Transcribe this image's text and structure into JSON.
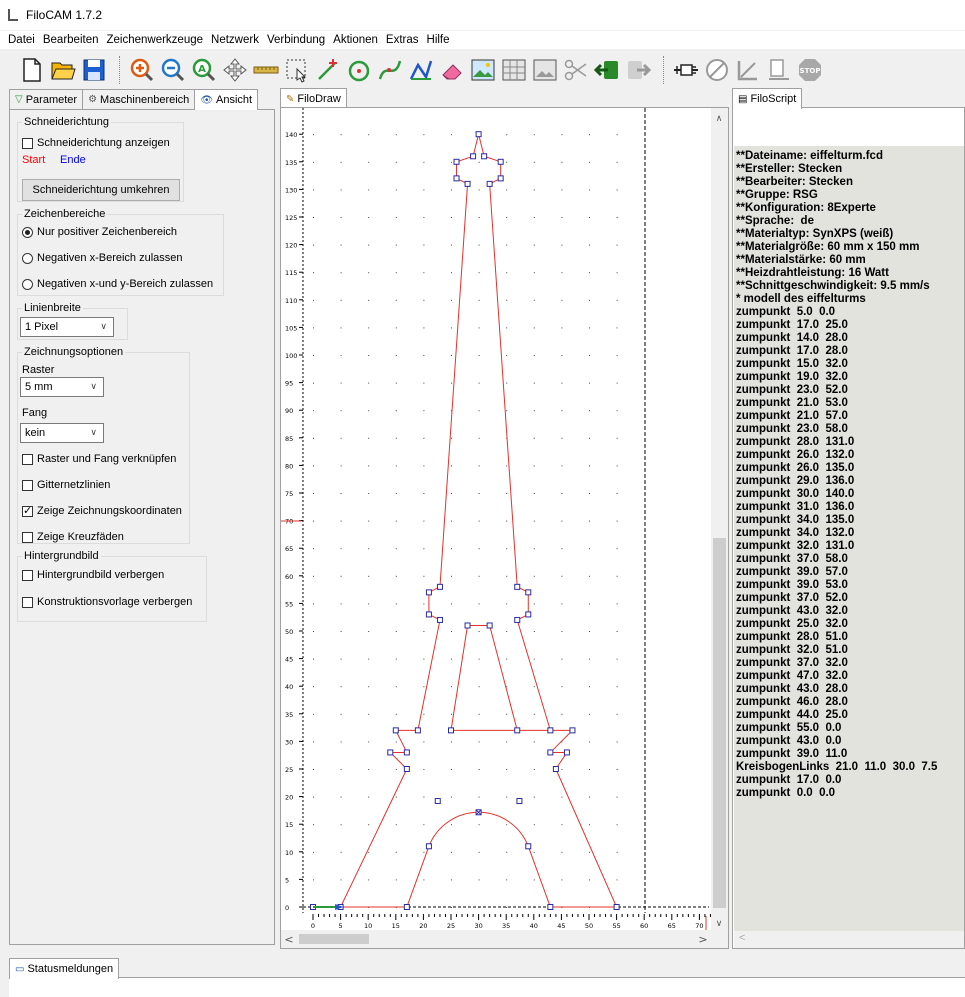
{
  "window": {
    "title": "FiloCAM 1.7.2"
  },
  "menu": [
    "Datei",
    "Bearbeiten",
    "Zeichenwerkzeuge",
    "Netzwerk",
    "Verbindung",
    "Aktionen",
    "Extras",
    "Hilfe"
  ],
  "left_tabs": {
    "parameter": "Parameter",
    "maschinenbereich": "Maschinenbereich",
    "ansicht": "Ansicht"
  },
  "schneiderichtung": {
    "title": "Schneiderichtung",
    "show_label": "Schneiderichtung anzeigen",
    "start": "Start",
    "ende": "Ende",
    "reverse_button": "Schneiderichtung umkehren"
  },
  "zeichenbereiche": {
    "title": "Zeichenbereiche",
    "opt1": "Nur positiver Zeichenbereich",
    "opt2": "Negativen x-Bereich zulassen",
    "opt3": "Negativen x-und y-Bereich zulassen"
  },
  "linienbreite": {
    "title": "Linienbreite",
    "value": "1 Pixel"
  },
  "zeichnungsoptionen": {
    "title": "Zeichnungsoptionen",
    "raster_label": "Raster",
    "raster_value": "5 mm",
    "fang_label": "Fang",
    "fang_value": "kein",
    "link_label": "Raster und Fang verknüpfen",
    "grid_label": "Gitternetzlinien",
    "coords_label": "Zeige Zeichnungskoordinaten",
    "cross_label": "Zeige Kreuzfäden"
  },
  "hintergrundbild": {
    "title": "Hintergrundbild",
    "hide_bg": "Hintergrundbild verbergen",
    "hide_template": "Konstruktionsvorlage verbergen"
  },
  "draw_tab": "FiloDraw",
  "script_tab": "FiloScript",
  "status_tab": "Statusmeldungen",
  "colors": {
    "start": "#ff0000",
    "ende": "#0000ff",
    "line": "#e8302a",
    "node": "#2a2aa8"
  },
  "axis": {
    "x_ticks": [
      "0",
      "5",
      "10",
      "15",
      "20",
      "25",
      "30",
      "35",
      "40",
      "45",
      "50",
      "55",
      "60",
      "65",
      "70"
    ],
    "y_ticks": [
      "0",
      "5",
      "10",
      "15",
      "20",
      "25",
      "30",
      "35",
      "40",
      "45",
      "50",
      "55",
      "60",
      "65",
      "70",
      "75",
      "80",
      "85",
      "90",
      "95",
      "100",
      "105",
      "110",
      "115",
      "120",
      "125",
      "130",
      "135",
      "140"
    ]
  },
  "script_lines": [
    "**Dateiname: eiffelturm.fcd",
    "**Ersteller: Stecken",
    "**Bearbeiter: Stecken",
    "**Gruppe: RSG",
    "**Konfiguration: 8Experte",
    "**Sprache:  de",
    "**Materialtyp: SynXPS (weiß)",
    "**Materialgröße: 60 mm x 150 mm",
    "**Materialstärke: 60 mm",
    "**Heizdrahtleistung: 16 Watt",
    "**Schnittgeschwindigkeit: 9.5 mm/s",
    "* modell des eiffelturms",
    "zumpunkt  5.0  0.0",
    "zumpunkt  17.0  25.0",
    "zumpunkt  14.0  28.0",
    "zumpunkt  17.0  28.0",
    "zumpunkt  15.0  32.0",
    "zumpunkt  19.0  32.0",
    "zumpunkt  23.0  52.0",
    "zumpunkt  21.0  53.0",
    "zumpunkt  21.0  57.0",
    "zumpunkt  23.0  58.0",
    "zumpunkt  28.0  131.0",
    "zumpunkt  26.0  132.0",
    "zumpunkt  26.0  135.0",
    "zumpunkt  29.0  136.0",
    "zumpunkt  30.0  140.0",
    "zumpunkt  31.0  136.0",
    "zumpunkt  34.0  135.0",
    "zumpunkt  34.0  132.0",
    "zumpunkt  32.0  131.0",
    "zumpunkt  37.0  58.0",
    "zumpunkt  39.0  57.0",
    "zumpunkt  39.0  53.0",
    "zumpunkt  37.0  52.0",
    "zumpunkt  43.0  32.0",
    "zumpunkt  25.0  32.0",
    "zumpunkt  28.0  51.0",
    "zumpunkt  32.0  51.0",
    "zumpunkt  37.0  32.0",
    "zumpunkt  47.0  32.0",
    "zumpunkt  43.0  28.0",
    "zumpunkt  46.0  28.0",
    "zumpunkt  44.0  25.0",
    "zumpunkt  55.0  0.0",
    "zumpunkt  43.0  0.0",
    "zumpunkt  39.0  11.0",
    "KreisbogenLinks  21.0  11.0  30.0  7.5",
    "zumpunkt  17.0  0.0",
    "zumpunkt  0.0  0.0"
  ],
  "path": [
    [
      0,
      0
    ],
    [
      5,
      0
    ],
    [
      17,
      25
    ],
    [
      14,
      28
    ],
    [
      17,
      28
    ],
    [
      15,
      32
    ],
    [
      19,
      32
    ],
    [
      23,
      52
    ],
    [
      21,
      53
    ],
    [
      21,
      57
    ],
    [
      23,
      58
    ],
    [
      28,
      131
    ],
    [
      26,
      132
    ],
    [
      26,
      135
    ],
    [
      29,
      136
    ],
    [
      30,
      140
    ],
    [
      31,
      136
    ],
    [
      34,
      135
    ],
    [
      34,
      132
    ],
    [
      32,
      131
    ],
    [
      37,
      58
    ],
    [
      39,
      57
    ],
    [
      39,
      53
    ],
    [
      37,
      52
    ],
    [
      43,
      32
    ],
    [
      25,
      32
    ],
    [
      28,
      51
    ],
    [
      32,
      51
    ],
    [
      37,
      32
    ],
    [
      47,
      32
    ],
    [
      43,
      28
    ],
    [
      46,
      28
    ],
    [
      44,
      25
    ],
    [
      55,
      0
    ],
    [
      43,
      0
    ],
    [
      39,
      11
    ]
  ],
  "arc": {
    "from": [
      39,
      11
    ],
    "to": [
      21,
      11
    ],
    "center": [
      30,
      7.5
    ]
  },
  "path_end": [
    [
      21,
      11
    ],
    [
      17,
      0
    ],
    [
      0,
      0
    ]
  ]
}
